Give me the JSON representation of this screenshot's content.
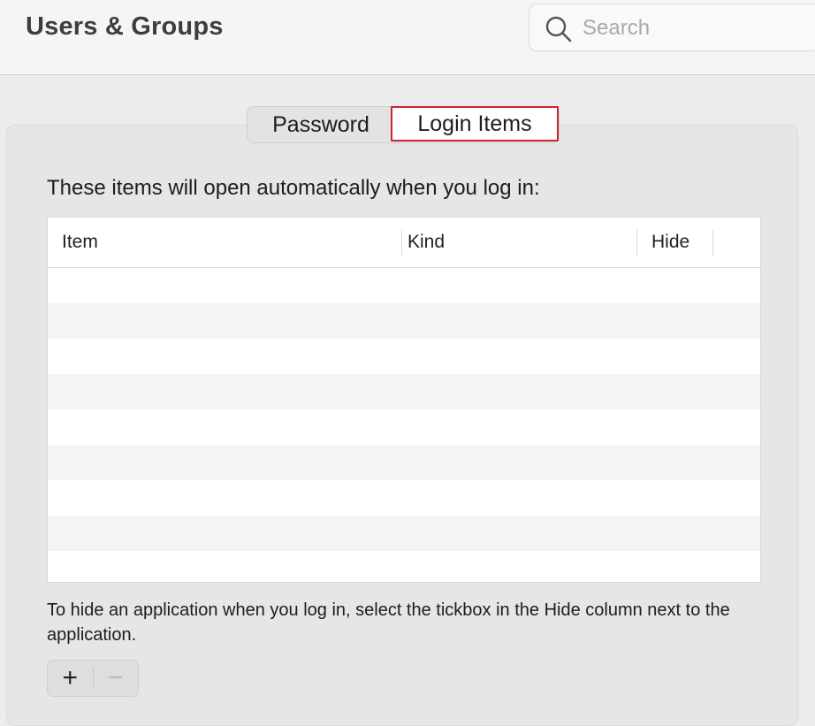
{
  "window": {
    "title": "Users & Groups"
  },
  "search": {
    "placeholder": "Search",
    "value": ""
  },
  "tabs": [
    {
      "label": "Password",
      "selected": false
    },
    {
      "label": "Login Items",
      "selected": true,
      "highlight_color": "#c8262c"
    }
  ],
  "login_items": {
    "description": "These items will open automatically when you log in:",
    "columns": [
      "Item",
      "Kind",
      "Hide"
    ],
    "rows": [],
    "help_text": "To hide an application when you log in, select the tickbox in the Hide column next to the application."
  },
  "controls": {
    "add_label": "+",
    "remove_label": "−",
    "remove_enabled": false
  }
}
